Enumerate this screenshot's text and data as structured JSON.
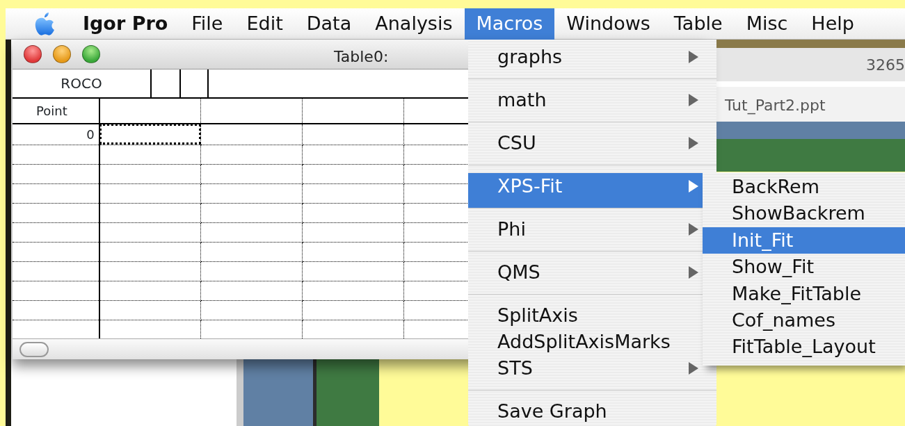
{
  "menubar": {
    "app": "Igor Pro",
    "items": [
      {
        "label": "File",
        "selected": false
      },
      {
        "label": "Edit",
        "selected": false
      },
      {
        "label": "Data",
        "selected": false
      },
      {
        "label": "Analysis",
        "selected": false
      },
      {
        "label": "Macros",
        "selected": true
      },
      {
        "label": "Windows",
        "selected": false
      },
      {
        "label": "Table",
        "selected": false
      },
      {
        "label": "Misc",
        "selected": false
      },
      {
        "label": "Help",
        "selected": false
      }
    ]
  },
  "background_window": {
    "title": "3265",
    "document": "Tut_Part2.ppt"
  },
  "table_window": {
    "title": "Table0:",
    "top_row": [
      "ROCO"
    ],
    "index_header": "Point",
    "rows": [
      {
        "point": "0",
        "selected": true
      },
      {
        "selected": false
      },
      {
        "selected": false
      },
      {
        "selected": false
      },
      {
        "selected": false
      },
      {
        "selected": false
      },
      {
        "selected": false
      },
      {
        "selected": false
      },
      {
        "selected": false
      },
      {
        "selected": false
      },
      {
        "selected": false
      }
    ]
  },
  "macros_menu": {
    "items": [
      {
        "label": "graphs",
        "submenu": true,
        "selected": false,
        "separator_after": true
      },
      {
        "label": "math",
        "submenu": true,
        "selected": false,
        "separator_after": true
      },
      {
        "label": "CSU",
        "submenu": true,
        "selected": false,
        "separator_after": true
      },
      {
        "label": "XPS-Fit",
        "submenu": true,
        "selected": true,
        "separator_after": true
      },
      {
        "label": "Phi",
        "submenu": true,
        "selected": false,
        "separator_after": true
      },
      {
        "label": "QMS",
        "submenu": true,
        "selected": false,
        "separator_after": true
      },
      {
        "label": "SplitAxis",
        "submenu": false,
        "selected": false,
        "separator_after": false
      },
      {
        "label": "AddSplitAxisMarks",
        "submenu": false,
        "selected": false,
        "separator_after": false
      },
      {
        "label": "STS",
        "submenu": true,
        "selected": false,
        "separator_after": true
      },
      {
        "label": "Save Graph",
        "submenu": false,
        "selected": false,
        "separator_after": false
      }
    ]
  },
  "xps_fit_submenu": {
    "items": [
      {
        "label": "BackRem",
        "selected": false
      },
      {
        "label": "ShowBackrem",
        "selected": false
      },
      {
        "label": "Init_Fit",
        "selected": true
      },
      {
        "label": "Show_Fit",
        "selected": false
      },
      {
        "label": "Make_FitTable",
        "selected": false
      },
      {
        "label": "Cof_names",
        "selected": false
      },
      {
        "label": "FitTable_Layout",
        "selected": false
      }
    ]
  }
}
